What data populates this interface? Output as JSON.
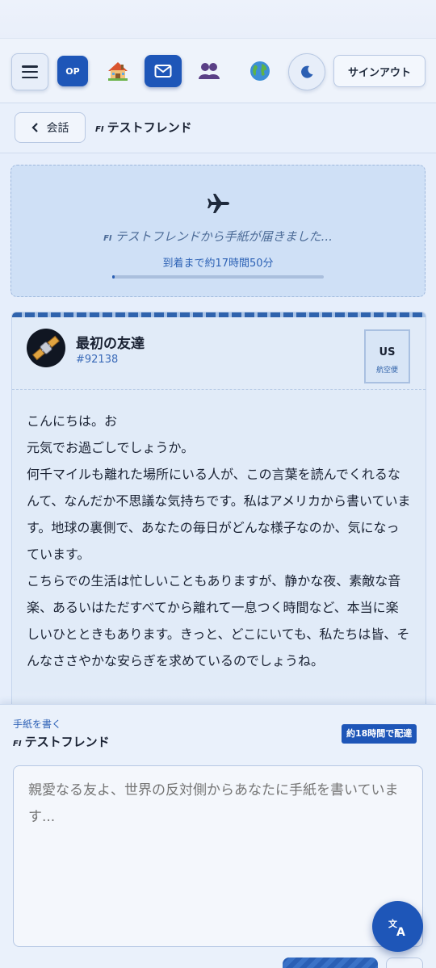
{
  "nav": {
    "op_label": "OP",
    "signout_label": "サインアウト"
  },
  "conversation": {
    "back_label": "会話",
    "flag_code": "FI",
    "friend_name": "テストフレンド"
  },
  "transit": {
    "flag_code": "FI",
    "message": "テストフレンドから手紙が届きました...",
    "eta": "到着まで約17時間50分",
    "progress": 0.01
  },
  "letter": {
    "title": "最初の友達",
    "id": "#92138",
    "stamp_code": "US",
    "stamp_label": "航空便",
    "paragraphs": [
      "こんにちは。お",
      "元気でお過ごしでしょうか。",
      "何千マイルも離れた場所にいる人が、この言葉を読んでくれるなんて、なんだか不思議な気持ちです。私はアメリカから書いています。地球の裏側で、あなたの毎日がどんな様子なのか、気になっています。",
      "こちらでの生活は忙しいこともありますが、静かな夜、素敵な音楽、あるいはただすべてから離れて一息つく時間など、本当に楽しいひとときもあります。きっと、どこにいても、私たちは皆、そんなささやかな安らぎを求めているのでしょうね。"
    ]
  },
  "compose": {
    "label": "手紙を書く",
    "flag_code": "FI",
    "recipient": "テストフレンド",
    "delivery_badge": "約18時間で配達",
    "placeholder": "親愛なる友よ、世界の反対側からあなたに手紙を書いています..."
  },
  "icons": {
    "menu": "hamburger-menu-icon",
    "home": "house-icon",
    "mail": "envelope-icon",
    "friends": "people-icon",
    "globe": "globe-icon",
    "theme": "moon-icon",
    "back": "chevron-left-icon",
    "plane": "airplane-icon",
    "avatar": "satellite-icon",
    "translate": "translate-icon"
  },
  "colors": {
    "accent": "#1e56b8",
    "page_bg": "#e6eefb",
    "transit_bg": "#cfe0f6"
  }
}
